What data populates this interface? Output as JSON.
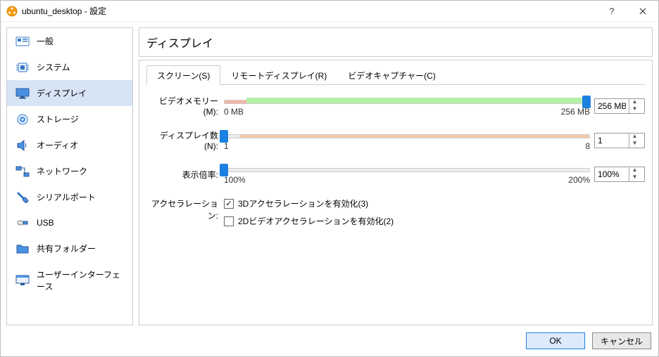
{
  "titlebar": {
    "title": "ubuntu_desktop - 設定"
  },
  "sidebar": {
    "items": [
      {
        "label": "一般"
      },
      {
        "label": "システム"
      },
      {
        "label": "ディスプレイ"
      },
      {
        "label": "ストレージ"
      },
      {
        "label": "オーディオ"
      },
      {
        "label": "ネットワーク"
      },
      {
        "label": "シリアルポート"
      },
      {
        "label": "USB"
      },
      {
        "label": "共有フォルダー"
      },
      {
        "label": "ユーザーインターフェース"
      }
    ]
  },
  "page": {
    "title": "ディスプレイ"
  },
  "tabs": {
    "screen": "スクリーン(S)",
    "remote": "リモートディスプレイ(R)",
    "capture": "ビデオキャプチャー(C)"
  },
  "form": {
    "vmem_label": "ビデオメモリー(M):",
    "vmem_value": "256 MB",
    "vmem_min": "0 MB",
    "vmem_max": "256 MB",
    "dcount_label": "ディスプレイ数(N):",
    "dcount_value": "1",
    "dcount_min": "1",
    "dcount_max": "8",
    "scale_label": "表示倍率:",
    "scale_value": "100%",
    "scale_min": "100%",
    "scale_max": "200%",
    "accel_label": "アクセラレーション:",
    "accel_3d": "3Dアクセラレーションを有効化(3)",
    "accel_2d": "2Dビデオアクセラレーションを有効化(2)"
  },
  "buttons": {
    "ok": "OK",
    "cancel": "キャンセル"
  }
}
